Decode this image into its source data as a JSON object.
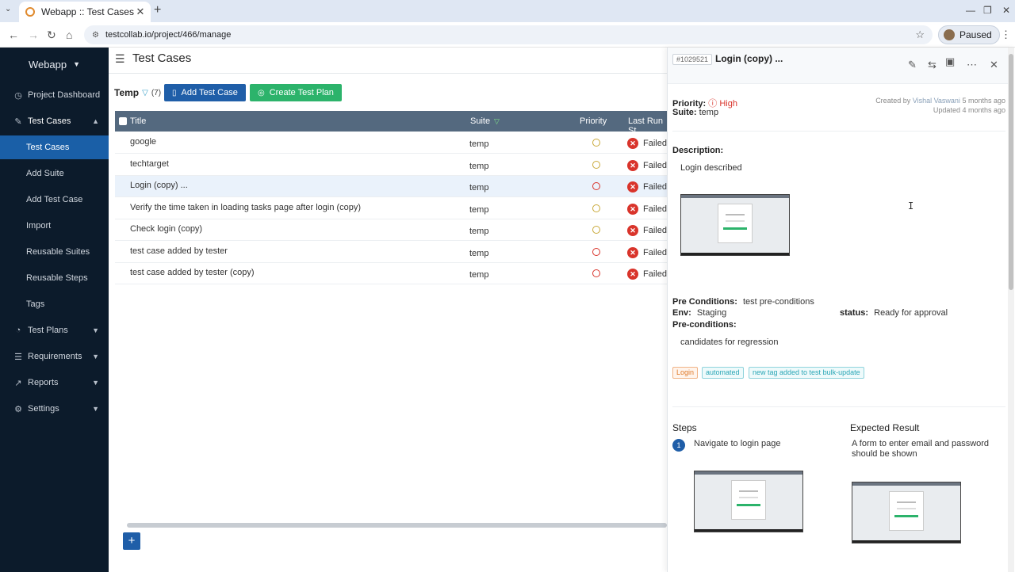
{
  "browser": {
    "tab_title": "Webapp :: Test Cases",
    "url": "testcollab.io/project/466/manage",
    "profile_label": "Paused"
  },
  "sidebar": {
    "brand": "Webapp",
    "items": [
      {
        "label": "Project Dashboard",
        "icon": "dashboard-icon"
      },
      {
        "label": "Test Cases",
        "icon": "edit-icon"
      },
      {
        "label": "Test Cases"
      },
      {
        "label": "Add Suite"
      },
      {
        "label": "Add Test Case"
      },
      {
        "label": "Import"
      },
      {
        "label": "Reusable Suites"
      },
      {
        "label": "Reusable Steps"
      },
      {
        "label": "Tags"
      },
      {
        "label": "Test Plans",
        "icon": "clock-icon"
      },
      {
        "label": "Requirements",
        "icon": "list-icon"
      },
      {
        "label": "Reports",
        "icon": "chart-icon"
      },
      {
        "label": "Settings",
        "icon": "gear-icon"
      }
    ]
  },
  "main": {
    "title": "Test Cases",
    "suite_name": "Temp",
    "suite_count": "(7)",
    "add_button": "Add Test Case",
    "plan_button": "Create Test Plan",
    "columns": {
      "title": "Title",
      "suite": "Suite",
      "priority": "Priority",
      "last_run": "Last Run St"
    },
    "rows": [
      {
        "title": "google",
        "suite": "temp",
        "priority": "normal",
        "status": "Failed"
      },
      {
        "title": "techtarget",
        "suite": "temp",
        "priority": "normal",
        "status": "Failed"
      },
      {
        "title": "Login (copy) ...",
        "suite": "temp",
        "priority": "high",
        "status": "Failed"
      },
      {
        "title": "Verify the time taken in loading tasks page after login (copy)",
        "suite": "temp",
        "priority": "normal",
        "status": "Failed"
      },
      {
        "title": "Check login (copy)",
        "suite": "temp",
        "priority": "normal",
        "status": "Failed"
      },
      {
        "title": "test case added by tester",
        "suite": "temp",
        "priority": "high",
        "status": "Failed"
      },
      {
        "title": "test case added by tester (copy)",
        "suite": "temp",
        "priority": "high",
        "status": "Failed"
      }
    ]
  },
  "panel": {
    "id": "#1029521",
    "title": "Login (copy) ...",
    "priority_label": "Priority:",
    "priority_value": "High",
    "suite_label": "Suite:",
    "suite_value": "temp",
    "created_prefix": "Created by",
    "created_by": "Vishal Vaswani",
    "created_ago": "5 months ago",
    "updated": "Updated 4 months ago",
    "description_label": "Description:",
    "description": "Login described",
    "preconditions_label": "Pre Conditions:",
    "preconditions_value": "test pre-conditions",
    "env_label": "Env:",
    "env_value": "Staging",
    "status_label": "status:",
    "status_value": "Ready for approval",
    "preconditions2_label": "Pre-conditions:",
    "preconditions2_value": "candidates for regression",
    "tags": [
      "Login",
      "automated",
      "new tag added to test bulk-update"
    ],
    "steps_header": "Steps",
    "expected_header": "Expected Result",
    "steps": [
      {
        "num": "1",
        "step": "Navigate to login page",
        "expected": "A form to enter email and password should be shown"
      }
    ]
  }
}
